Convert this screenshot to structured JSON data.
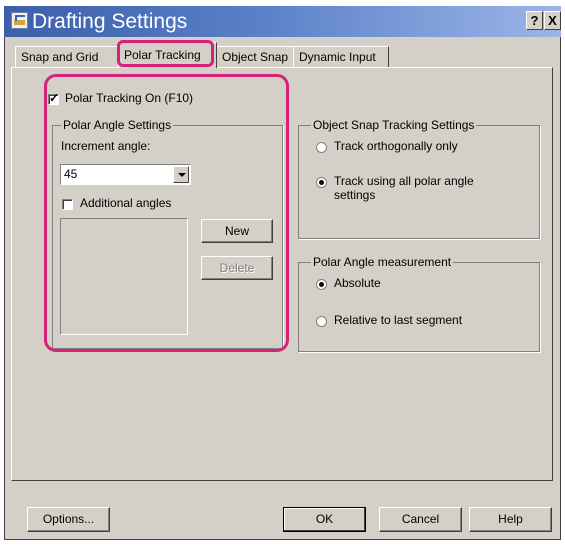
{
  "window": {
    "title": "Drafting Settings",
    "help_glyph": "?",
    "close_glyph": "X"
  },
  "tabs": [
    "Snap and Grid",
    "Polar Tracking",
    "Object Snap",
    "Dynamic Input"
  ],
  "active_tab": "Polar Tracking",
  "polar_on": {
    "label": "Polar Tracking On (F10)",
    "checked": true
  },
  "polar_angle": {
    "group_title": "Polar Angle Settings",
    "increment_label": "Increment angle:",
    "increment_value": "45",
    "additional_label": "Additional angles",
    "additional_checked": false,
    "new_label": "New",
    "delete_label": "Delete"
  },
  "snap_tracking": {
    "group_title": "Object Snap Tracking Settings",
    "option1": "Track orthogonally only",
    "option2_line1": "Track using all polar angle",
    "option2_line2": "settings",
    "selected": 2
  },
  "angle_measure": {
    "group_title": "Polar Angle measurement",
    "option1": "Absolute",
    "option2": "Relative to last segment",
    "selected": 1
  },
  "footer": {
    "options": "Options...",
    "ok": "OK",
    "cancel": "Cancel",
    "help": "Help"
  },
  "colors": {
    "highlight": "#d6237a",
    "dialog_bg": "#d4d0c8",
    "title_start": "#3d5ea8",
    "title_end": "#9bb5e6"
  }
}
